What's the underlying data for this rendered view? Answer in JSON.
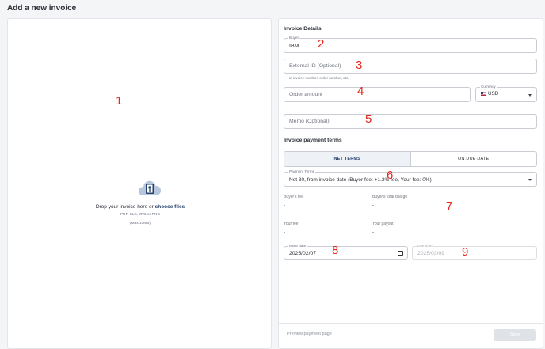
{
  "page": {
    "title": "Add a new invoice"
  },
  "upload": {
    "icon": "cloud-upload-icon",
    "prompt": "Drop your invoice here or",
    "link": "choose files",
    "formats": "PDF, XLS, JPG or PNG",
    "max_size": "(Max 10MB)"
  },
  "details": {
    "title": "Invoice Details",
    "buyer": {
      "label": "Buyer",
      "value": "IBM"
    },
    "external_id": {
      "placeholder": "External ID (Optional)",
      "helper": "ie invoice number, order number, etc."
    },
    "order_amount": {
      "placeholder": "Order amount"
    },
    "currency": {
      "label": "Currency",
      "value": "USD",
      "icon": "us-flag-icon"
    },
    "memo": {
      "placeholder": "Memo (Optional)"
    }
  },
  "terms": {
    "title": "Invoice payment terms",
    "tabs": [
      {
        "label": "NET TERMS",
        "active": true
      },
      {
        "label": "ON DUE DATE",
        "active": false
      }
    ],
    "payment_terms": {
      "label": "Payment Terms",
      "value": "Net 30, from invoice date (Buyer fee: +1.3% fee, Your fee: 0%)"
    }
  },
  "fees": {
    "buyers_fee": {
      "label": "Buyer's fee",
      "value": "-"
    },
    "buyers_total": {
      "label": "Buyer's total charge",
      "value": "-"
    },
    "your_fee": {
      "label": "Your fee",
      "value": "-"
    },
    "your_payout": {
      "label": "Your payout",
      "value": "-"
    }
  },
  "dates": {
    "issue": {
      "label": "Issue date",
      "value": "2025/02/07"
    },
    "due": {
      "label": "Due date",
      "value": "2025/03/09"
    }
  },
  "footer": {
    "preview_label": "Preview payment page",
    "save_label": "Save"
  },
  "annotations": [
    "1",
    "2",
    "3",
    "4",
    "5",
    "6",
    "7",
    "8",
    "9"
  ],
  "colors": {
    "accent": "#24416b",
    "annotation": "#e3261b",
    "toggle_active_bg": "#eef1f6"
  }
}
